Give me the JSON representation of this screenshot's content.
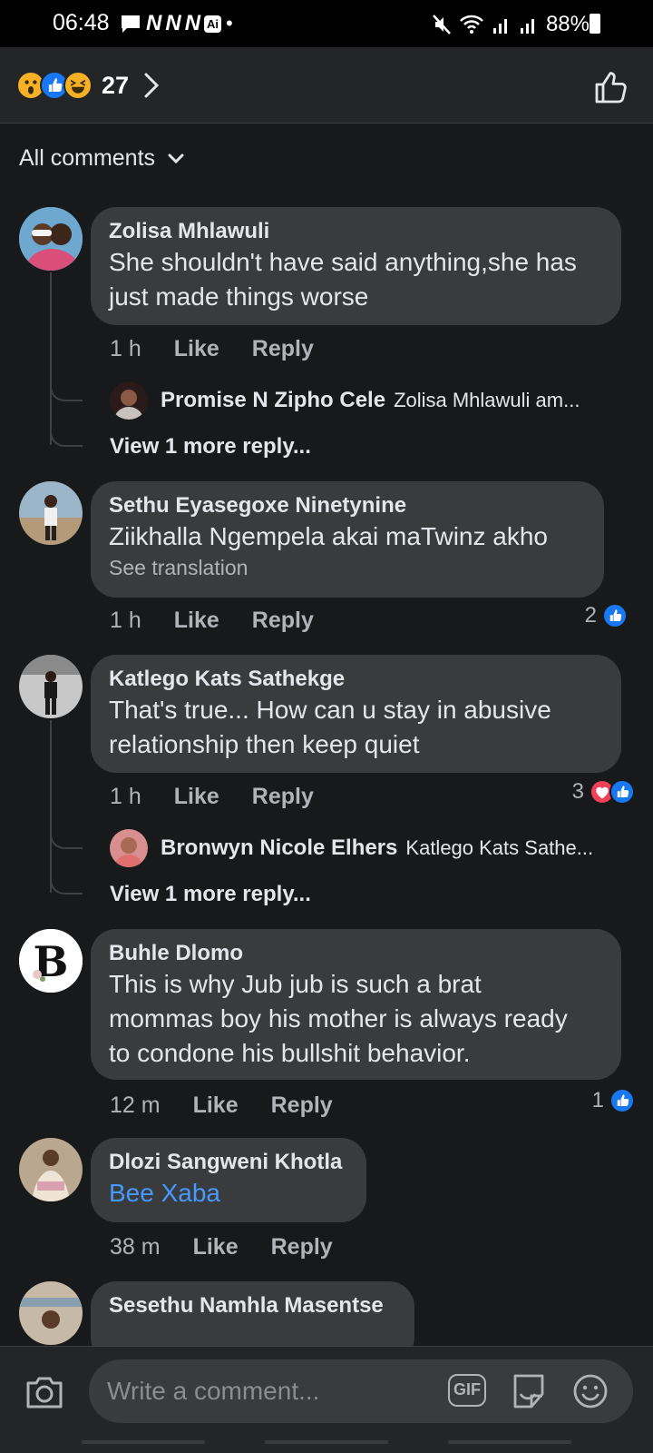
{
  "status_bar": {
    "time": "06:48",
    "n_icons": [
      "N",
      "N",
      "N"
    ],
    "ai_badge": "Ai",
    "dot": "•",
    "battery": "88%"
  },
  "header": {
    "reaction_icons": [
      "wow",
      "like",
      "haha"
    ],
    "reaction_count": "27"
  },
  "filter": {
    "label": "All comments"
  },
  "comments": [
    {
      "name": "Zolisa Mhlawuli",
      "lines": [
        "She shouldn't have said anything,she has",
        "just made things worse"
      ],
      "time": "1 h",
      "like": "Like",
      "reply": "Reply",
      "reply_preview": {
        "name": "Promise N Zipho Cele",
        "text": "Zolisa Mhlawuli am..."
      },
      "view_more": "View 1 more reply..."
    },
    {
      "name": "Sethu Eyasegoxe Ninetynine",
      "lines": [
        "Ziikhalla Ngempela akai maTwinz akho"
      ],
      "see_translation": "See translation",
      "time": "1 h",
      "like": "Like",
      "reply": "Reply",
      "reaction_count": "2",
      "reactions": [
        "like"
      ]
    },
    {
      "name": "Katlego Kats Sathekge",
      "lines": [
        "That's true... How can u stay in abusive",
        "relationship then keep quiet"
      ],
      "time": "1 h",
      "like": "Like",
      "reply": "Reply",
      "reaction_count": "3",
      "reactions": [
        "love",
        "like"
      ],
      "reply_preview": {
        "name": "Bronwyn Nicole Elhers",
        "text": "Katlego Kats Sathe..."
      },
      "view_more": "View 1 more reply..."
    },
    {
      "name": "Buhle Dlomo",
      "lines": [
        "This is why Jub jub is such a brat",
        "mommas boy his mother is always ready",
        "to condone his bullshit behavior."
      ],
      "time": "12 m",
      "like": "Like",
      "reply": "Reply",
      "reaction_count": "1",
      "reactions": [
        "like"
      ]
    },
    {
      "name": "Dlozi Sangweni Khotla",
      "link_text": "Bee Xaba",
      "time": "38 m",
      "like": "Like",
      "reply": "Reply"
    },
    {
      "name": "Sesethu Namhla Masentse"
    }
  ],
  "composer": {
    "placeholder": "Write a comment...",
    "gif_label": "GIF"
  },
  "colors": {
    "background": "#18191a",
    "bubble": "#3a3b3c",
    "link": "#4599ff",
    "like_blue": "#1877f2",
    "love_red": "#f33e58"
  }
}
